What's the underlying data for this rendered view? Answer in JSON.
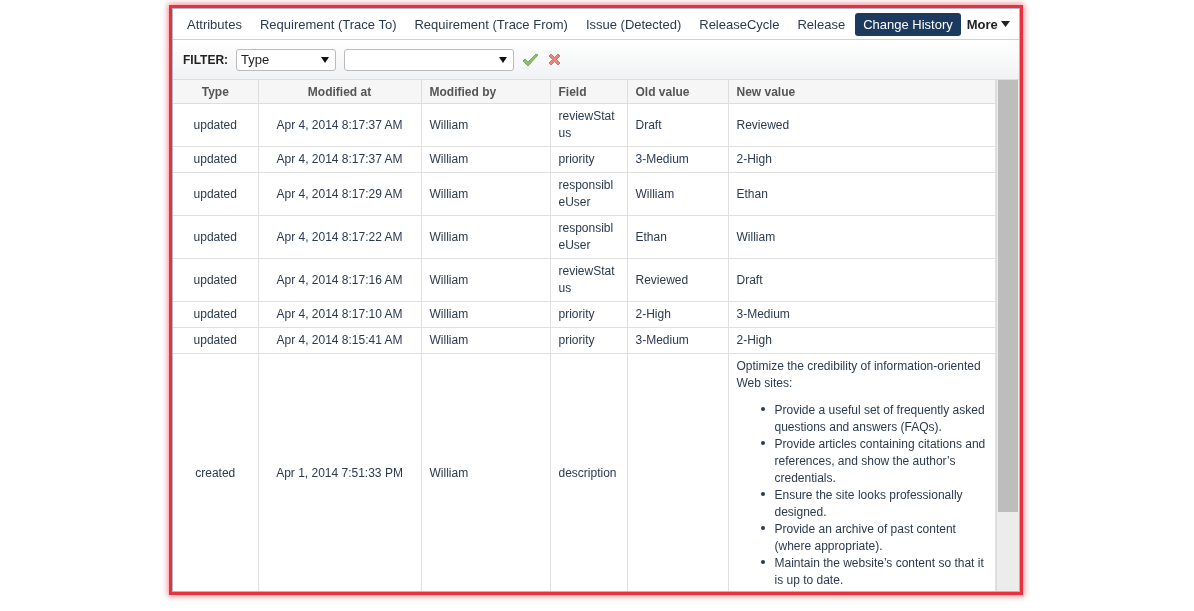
{
  "tabs": [
    {
      "label": "Attributes",
      "selected": false
    },
    {
      "label": "Requirement (Trace To)",
      "selected": false
    },
    {
      "label": "Requirement (Trace From)",
      "selected": false
    },
    {
      "label": "Issue (Detected)",
      "selected": false
    },
    {
      "label": "ReleaseCycle",
      "selected": false
    },
    {
      "label": "Release",
      "selected": false
    },
    {
      "label": "Change History",
      "selected": true
    }
  ],
  "more_menu": {
    "label": "More"
  },
  "filter": {
    "label": "FILTER:",
    "column_select": {
      "value": "Type"
    }
  },
  "table": {
    "columns": [
      "Type",
      "Modified at",
      "Modified by",
      "Field",
      "Old value",
      "New value"
    ],
    "rows": [
      {
        "type": "updated",
        "modified_at": "Apr 4, 2014 8:17:37 AM",
        "modified_by": "William",
        "field": "reviewStatus",
        "old_value": "Draft",
        "new_value": "Reviewed"
      },
      {
        "type": "updated",
        "modified_at": "Apr 4, 2014 8:17:37 AM",
        "modified_by": "William",
        "field": "priority",
        "old_value": "3-Medium",
        "new_value": "2-High"
      },
      {
        "type": "updated",
        "modified_at": "Apr 4, 2014 8:17:29 AM",
        "modified_by": "William",
        "field": "responsibleUser",
        "old_value": "William",
        "new_value": "Ethan"
      },
      {
        "type": "updated",
        "modified_at": "Apr 4, 2014 8:17:22 AM",
        "modified_by": "William",
        "field": "responsibleUser",
        "old_value": "Ethan",
        "new_value": "William"
      },
      {
        "type": "updated",
        "modified_at": "Apr 4, 2014 8:17:16 AM",
        "modified_by": "William",
        "field": "reviewStatus",
        "old_value": "Reviewed",
        "new_value": "Draft"
      },
      {
        "type": "updated",
        "modified_at": "Apr 4, 2014 8:17:10 AM",
        "modified_by": "William",
        "field": "priority",
        "old_value": "2-High",
        "new_value": "3-Medium"
      },
      {
        "type": "updated",
        "modified_at": "Apr 4, 2014 8:15:41 AM",
        "modified_by": "William",
        "field": "priority",
        "old_value": "3-Medium",
        "new_value": "2-High"
      },
      {
        "type": "created",
        "modified_at": "Apr 1, 2014 7:51:33 PM",
        "modified_by": "William",
        "field": "description",
        "old_value": "",
        "new_value": "Optimize the credibility of information-oriented Web sites:",
        "new_value_bullets": [
          "Provide a useful set of frequently asked questions and answers (FAQs).",
          "Provide articles containing citations and references, and show the author’s credentials.",
          "Ensure the site looks professionally designed.",
          "Provide an archive of past content (where appropriate).",
          "Maintain the website’s content so that it is up to date."
        ]
      }
    ]
  }
}
